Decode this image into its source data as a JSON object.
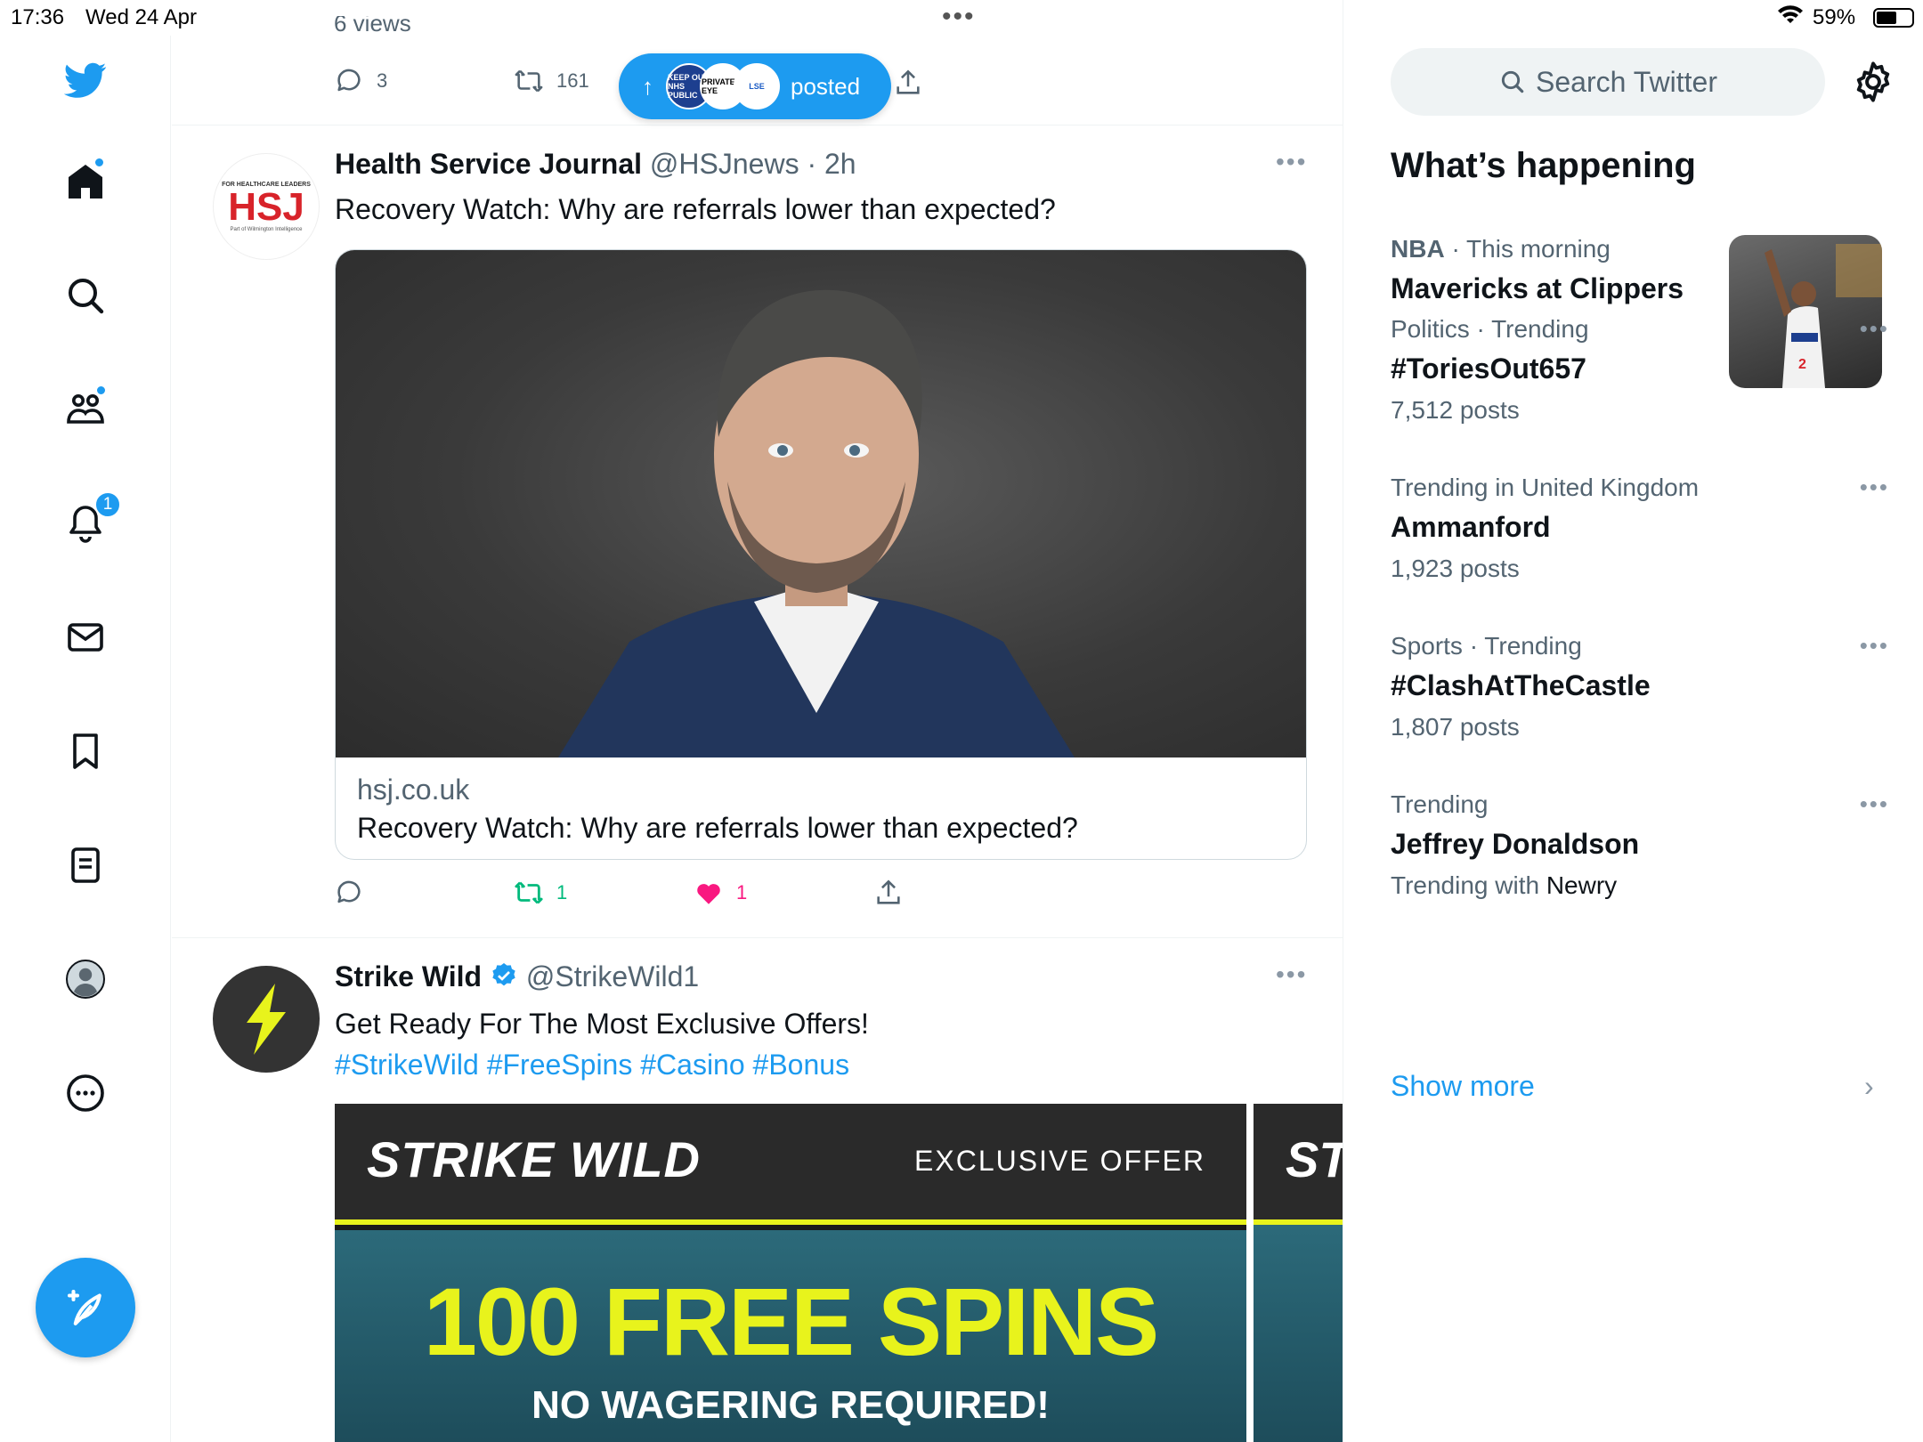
{
  "status": {
    "time": "17:36",
    "date": "Wed 24 Apr",
    "battery_pct": "59%",
    "battery_level": 0.59
  },
  "nav": {
    "notifications_count": "1"
  },
  "prev_tweet": {
    "views": "6 views",
    "replies": "3",
    "retweets": "161"
  },
  "posted_pill": {
    "label": "posted",
    "avatar_texts": [
      "KEEP OUR NHS PUBLIC",
      "PRIVATE EYE",
      "LSE"
    ]
  },
  "tweet1": {
    "avatar_text": "HSJ",
    "avatar_subtext_top": "FOR HEALTHCARE LEADERS",
    "avatar_subtext_bottom": "Part of Wilmington Intelligence",
    "name": "Health Service Journal",
    "handle": "@HSJnews",
    "sep": "·",
    "time": "2h",
    "text": "Recovery Watch: Why are referrals lower than expected?",
    "card_domain": "hsj.co.uk",
    "card_title": "Recovery Watch: Why are referrals lower than expected?",
    "retweets": "1",
    "likes": "1",
    "colors": {
      "retweeted": "#00ba7c",
      "liked": "#f91880"
    }
  },
  "tweet2": {
    "name": "Strike Wild",
    "handle": "@StrikeWild1",
    "text": "Get Ready For The Most Exclusive Offers!",
    "hashtags": "#StrikeWild #FreeSpins #Casino #Bonus",
    "promo": {
      "logo": "STRIKE WILD",
      "offer": "EXCLUSIVE OFFER",
      "headline": "100 FREE SPINS",
      "subline": "NO WAGERING REQUIRED!",
      "second_logo": "ST"
    }
  },
  "sidebar": {
    "search_placeholder": "Search Twitter",
    "title": "What’s happening",
    "trends": [
      {
        "ctx": "NBA",
        "ctx2": " · This morning",
        "title": "Mavericks at Clippers",
        "count": ""
      },
      {
        "ctx": "Politics · Trending",
        "title": "#ToriesOut657",
        "count": "7,512 posts"
      },
      {
        "ctx": "Trending in United Kingdom",
        "title": "Ammanford",
        "count": "1,923 posts"
      },
      {
        "ctx": "Sports · Trending",
        "title": "#ClashAtTheCastle",
        "count": "1,807 posts"
      },
      {
        "ctx": "Trending",
        "title": "Jeffrey Donaldson",
        "count_prefix": "Trending with ",
        "count_link": "Newry"
      }
    ],
    "show_more": "Show more"
  },
  "colors": {
    "accent": "#1d9bf0",
    "text": "#0f1419",
    "muted": "#536471",
    "promo_yellow": "#e8f31c"
  }
}
